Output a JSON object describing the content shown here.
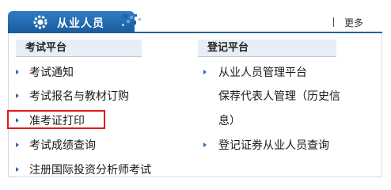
{
  "header": {
    "title": "从业人员",
    "more_label": "更多",
    "tab_icon": "gear-icon",
    "accent_color": "#1f63a4"
  },
  "columns": {
    "left": {
      "title": "考试平台",
      "items": [
        "考试通知",
        "考试报名与教材订购",
        "准考证打印",
        "考试成绩查询",
        "注册国际投资分析师考试"
      ]
    },
    "right": {
      "title": "登记平台",
      "items": [
        "从业人员管理平台",
        "保荐代表人管理（历史信",
        "息）",
        "登记证券从业人员查询"
      ]
    }
  },
  "highlight": {
    "item": "准考证打印",
    "color": "#e11818"
  }
}
